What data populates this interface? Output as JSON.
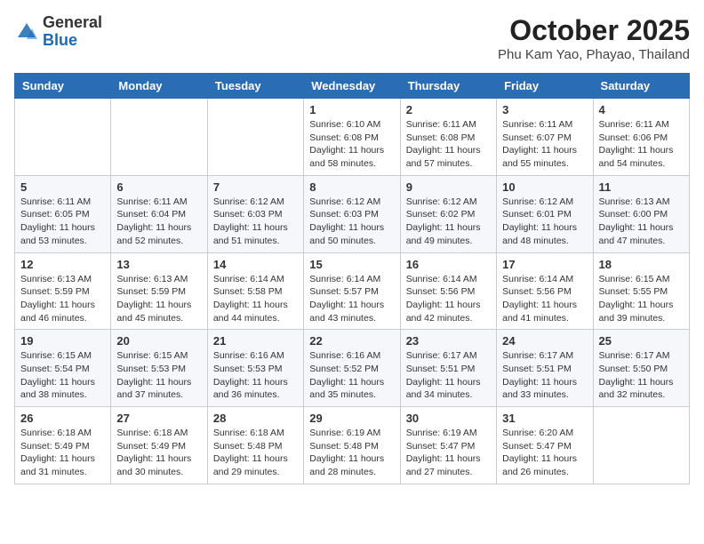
{
  "header": {
    "logo_general": "General",
    "logo_blue": "Blue",
    "month_title": "October 2025",
    "location": "Phu Kam Yao, Phayao, Thailand"
  },
  "weekdays": [
    "Sunday",
    "Monday",
    "Tuesday",
    "Wednesday",
    "Thursday",
    "Friday",
    "Saturday"
  ],
  "weeks": [
    [
      {
        "day": "",
        "info": ""
      },
      {
        "day": "",
        "info": ""
      },
      {
        "day": "",
        "info": ""
      },
      {
        "day": "1",
        "info": "Sunrise: 6:10 AM\nSunset: 6:08 PM\nDaylight: 11 hours\nand 58 minutes."
      },
      {
        "day": "2",
        "info": "Sunrise: 6:11 AM\nSunset: 6:08 PM\nDaylight: 11 hours\nand 57 minutes."
      },
      {
        "day": "3",
        "info": "Sunrise: 6:11 AM\nSunset: 6:07 PM\nDaylight: 11 hours\nand 55 minutes."
      },
      {
        "day": "4",
        "info": "Sunrise: 6:11 AM\nSunset: 6:06 PM\nDaylight: 11 hours\nand 54 minutes."
      }
    ],
    [
      {
        "day": "5",
        "info": "Sunrise: 6:11 AM\nSunset: 6:05 PM\nDaylight: 11 hours\nand 53 minutes."
      },
      {
        "day": "6",
        "info": "Sunrise: 6:11 AM\nSunset: 6:04 PM\nDaylight: 11 hours\nand 52 minutes."
      },
      {
        "day": "7",
        "info": "Sunrise: 6:12 AM\nSunset: 6:03 PM\nDaylight: 11 hours\nand 51 minutes."
      },
      {
        "day": "8",
        "info": "Sunrise: 6:12 AM\nSunset: 6:03 PM\nDaylight: 11 hours\nand 50 minutes."
      },
      {
        "day": "9",
        "info": "Sunrise: 6:12 AM\nSunset: 6:02 PM\nDaylight: 11 hours\nand 49 minutes."
      },
      {
        "day": "10",
        "info": "Sunrise: 6:12 AM\nSunset: 6:01 PM\nDaylight: 11 hours\nand 48 minutes."
      },
      {
        "day": "11",
        "info": "Sunrise: 6:13 AM\nSunset: 6:00 PM\nDaylight: 11 hours\nand 47 minutes."
      }
    ],
    [
      {
        "day": "12",
        "info": "Sunrise: 6:13 AM\nSunset: 5:59 PM\nDaylight: 11 hours\nand 46 minutes."
      },
      {
        "day": "13",
        "info": "Sunrise: 6:13 AM\nSunset: 5:59 PM\nDaylight: 11 hours\nand 45 minutes."
      },
      {
        "day": "14",
        "info": "Sunrise: 6:14 AM\nSunset: 5:58 PM\nDaylight: 11 hours\nand 44 minutes."
      },
      {
        "day": "15",
        "info": "Sunrise: 6:14 AM\nSunset: 5:57 PM\nDaylight: 11 hours\nand 43 minutes."
      },
      {
        "day": "16",
        "info": "Sunrise: 6:14 AM\nSunset: 5:56 PM\nDaylight: 11 hours\nand 42 minutes."
      },
      {
        "day": "17",
        "info": "Sunrise: 6:14 AM\nSunset: 5:56 PM\nDaylight: 11 hours\nand 41 minutes."
      },
      {
        "day": "18",
        "info": "Sunrise: 6:15 AM\nSunset: 5:55 PM\nDaylight: 11 hours\nand 39 minutes."
      }
    ],
    [
      {
        "day": "19",
        "info": "Sunrise: 6:15 AM\nSunset: 5:54 PM\nDaylight: 11 hours\nand 38 minutes."
      },
      {
        "day": "20",
        "info": "Sunrise: 6:15 AM\nSunset: 5:53 PM\nDaylight: 11 hours\nand 37 minutes."
      },
      {
        "day": "21",
        "info": "Sunrise: 6:16 AM\nSunset: 5:53 PM\nDaylight: 11 hours\nand 36 minutes."
      },
      {
        "day": "22",
        "info": "Sunrise: 6:16 AM\nSunset: 5:52 PM\nDaylight: 11 hours\nand 35 minutes."
      },
      {
        "day": "23",
        "info": "Sunrise: 6:17 AM\nSunset: 5:51 PM\nDaylight: 11 hours\nand 34 minutes."
      },
      {
        "day": "24",
        "info": "Sunrise: 6:17 AM\nSunset: 5:51 PM\nDaylight: 11 hours\nand 33 minutes."
      },
      {
        "day": "25",
        "info": "Sunrise: 6:17 AM\nSunset: 5:50 PM\nDaylight: 11 hours\nand 32 minutes."
      }
    ],
    [
      {
        "day": "26",
        "info": "Sunrise: 6:18 AM\nSunset: 5:49 PM\nDaylight: 11 hours\nand 31 minutes."
      },
      {
        "day": "27",
        "info": "Sunrise: 6:18 AM\nSunset: 5:49 PM\nDaylight: 11 hours\nand 30 minutes."
      },
      {
        "day": "28",
        "info": "Sunrise: 6:18 AM\nSunset: 5:48 PM\nDaylight: 11 hours\nand 29 minutes."
      },
      {
        "day": "29",
        "info": "Sunrise: 6:19 AM\nSunset: 5:48 PM\nDaylight: 11 hours\nand 28 minutes."
      },
      {
        "day": "30",
        "info": "Sunrise: 6:19 AM\nSunset: 5:47 PM\nDaylight: 11 hours\nand 27 minutes."
      },
      {
        "day": "31",
        "info": "Sunrise: 6:20 AM\nSunset: 5:47 PM\nDaylight: 11 hours\nand 26 minutes."
      },
      {
        "day": "",
        "info": ""
      }
    ]
  ]
}
